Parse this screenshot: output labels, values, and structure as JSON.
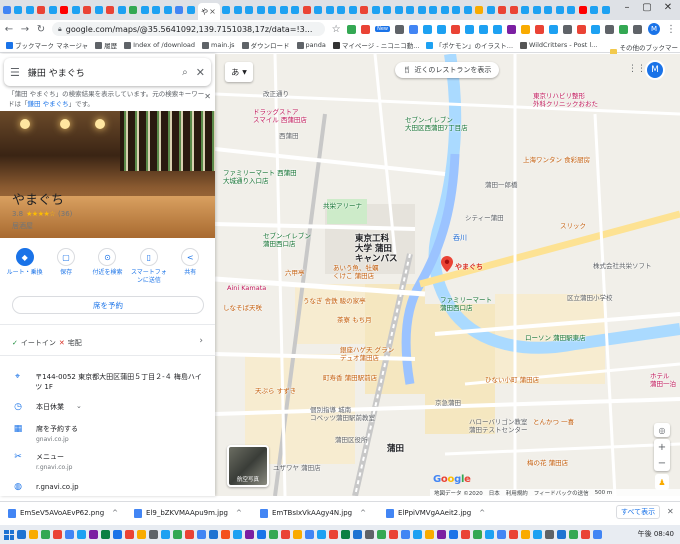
{
  "browser": {
    "active_tab_label": "や",
    "tab_colors": [
      "#4285f4",
      "#1da1f2",
      "#1da1f2",
      "#ea4335",
      "#1da1f2",
      "#ff0000",
      "#1da1f2",
      "#ea4335",
      "#1da1f2",
      "#ea4335",
      "#1da1f2",
      "#34a853",
      "#1da1f2",
      "#1da1f2",
      "#1da1f2",
      "#4285f4",
      "#1da1f2",
      "#1da1f2",
      "#1da1f2",
      "#1da1f2",
      "#1da1f2",
      "#1da1f2",
      "#1da1f2",
      "#1da1f2",
      "#ea4335",
      "#1da1f2",
      "#1da1f2",
      "#1da1f2",
      "#1da1f2",
      "#ea4335",
      "#1da1f2",
      "#1da1f2",
      "#1da1f2",
      "#1da1f2",
      "#1da1f2",
      "#1da1f2",
      "#1da1f2",
      "#1da1f2",
      "#1da1f2",
      "#f9ab00",
      "#1da1f2",
      "#ea4335",
      "#ea4335",
      "#1da1f2",
      "#1da1f2",
      "#1da1f2",
      "#1da1f2",
      "#1da1f2",
      "#ff0000",
      "#1da1f2",
      "#1da1f2"
    ],
    "url": "google.com/maps/@35.5641092,139.7151038,17z/data=!3...",
    "new_badge": "New",
    "account_initial": "M"
  },
  "bookmarks": [
    {
      "label": "ブックマーク マネージャ",
      "color": "#1a73e8"
    },
    {
      "label": "履歴",
      "color": "#5f6368"
    },
    {
      "label": "Index of /download",
      "color": "#5f6368"
    },
    {
      "label": "main.js",
      "color": "#5f6368"
    },
    {
      "label": "ダウンロード",
      "color": "#5f6368"
    },
    {
      "label": "panda",
      "color": "#5f6368"
    },
    {
      "label": "マイページ - ニコニコ動...",
      "color": "#333333"
    },
    {
      "label": "「ポケモン」のイラスト...",
      "color": "#1da1f2"
    },
    {
      "label": "WildCritters - Post l...",
      "color": "#555555"
    }
  ],
  "other_bookmarks": "その他のブックマーク",
  "panel": {
    "search_value": "鎌田 やまぐち",
    "notice_prefix": "「蒲田 やまぐち」の検索結果を表示しています。元の検索キーワードは「",
    "notice_term": "鎌田 やまぐち",
    "notice_suffix": "」です。",
    "place_name": "やまぐち",
    "rating_value": "3.8",
    "stars": "★★★★☆",
    "review_count": "(36)",
    "category": "居酒屋",
    "actions": [
      {
        "label": "ルート・乗換",
        "icon": "◆"
      },
      {
        "label": "保存",
        "icon": "▢"
      },
      {
        "label": "付近を検索",
        "icon": "⊙"
      },
      {
        "label": "スマートフォンに送信",
        "icon": "▯"
      },
      {
        "label": "共有",
        "icon": "<"
      }
    ],
    "reserve_label": "席を予約",
    "service_eatin": "イートイン",
    "service_takeout": "宅配",
    "address": "〒144-0052 東京都大田区蒲田５丁目２-４ 梅島ハイツ 1F",
    "hours": "本日休業",
    "reserve_row": "席を予約する",
    "reserve_row_sub": "gnavi.co.jp",
    "menu_row": "メニュー",
    "menu_row_sub": "r.gnavi.co.jp",
    "website": "r.gnavi.co.jp"
  },
  "map": {
    "lang_label": "あ",
    "nearby_label": "近くのレストランを表示",
    "pin_label": "やまぐち",
    "sat_label": "航空写真",
    "labels": [
      {
        "t": "ドラッグストア\nスマイル 西蒲田店",
        "c": "ml-pink"
      },
      {
        "t": "改正通り",
        "c": ""
      },
      {
        "t": "西蒲田",
        "c": ""
      },
      {
        "t": "セブン-イレブン\n大田区西蒲田7丁目店",
        "c": "ml-green"
      },
      {
        "t": "ファミリーマート 西蒲田\n大城通り入口店",
        "c": "ml-green"
      },
      {
        "t": "共栄アリーナ",
        "c": "ml-green"
      },
      {
        "t": "セブン-イレブン\n蒲田西口店",
        "c": "ml-green"
      },
      {
        "t": "東京工科\n大学 蒲田\nキャンパス",
        "c": "ml-big"
      },
      {
        "t": "あいう魚、牡蠣\nくけこ 蒲田店",
        "c": "ml-orange"
      },
      {
        "t": "うなぎ 舎鉄 駿の家亭",
        "c": "ml-orange"
      },
      {
        "t": "茶寮 もち月",
        "c": "ml-orange"
      },
      {
        "t": "しなそば天咲",
        "c": "ml-orange"
      },
      {
        "t": "銀座ハゲ天 グラン\nデュオ蒲田店",
        "c": "ml-orange"
      },
      {
        "t": "町寿香 蒲田駅前店",
        "c": "ml-orange"
      },
      {
        "t": "天ぷら すずき",
        "c": "ml-orange"
      },
      {
        "t": "個別指導 城南\nコベッツ蒲田駅前教室",
        "c": ""
      },
      {
        "t": "蒲田区役所",
        "c": ""
      },
      {
        "t": "ユザワヤ 蒲田店",
        "c": ""
      },
      {
        "t": "蒲田",
        "c": "ml-big"
      },
      {
        "t": "東京リハビリ整形\n外科クリニックおおた",
        "c": "ml-pink"
      },
      {
        "t": "上海ワンタン 食彩厨房",
        "c": "ml-orange"
      },
      {
        "t": "蒲田一郎橋",
        "c": ""
      },
      {
        "t": "シティー蒲田",
        "c": ""
      },
      {
        "t": "スリック",
        "c": "ml-orange"
      },
      {
        "t": "株式会社共栄ソフト",
        "c": ""
      },
      {
        "t": "ファミリーマート\n蒲田西口店",
        "c": "ml-green"
      },
      {
        "t": "ローソン 蒲田駅東店",
        "c": "ml-green"
      },
      {
        "t": "区立蒲田小学校",
        "c": ""
      },
      {
        "t": "ひない小町 蒲田店",
        "c": "ml-orange"
      },
      {
        "t": "ハローバリゴン教室\n蒲田テストセンター",
        "c": ""
      },
      {
        "t": "とんかつ 一喜",
        "c": "ml-orange"
      },
      {
        "t": "梅の花 蒲田店",
        "c": "ml-orange"
      },
      {
        "t": "呑川",
        "c": "ml-river"
      },
      {
        "t": "ホテル\n蒲田一泊",
        "c": "ml-pink"
      },
      {
        "t": "Aini Kamata",
        "c": "ml-pink"
      },
      {
        "t": "六甲亭",
        "c": "ml-orange"
      },
      {
        "t": "京急蒲田",
        "c": ""
      }
    ],
    "footer": [
      "地図データ ©2020",
      "日本",
      "利用規約",
      "フィードバックの送信",
      "500 m"
    ]
  },
  "downloads": [
    "EmSeV5AVoAEvP62.png",
    "El9_bZKVMAApu9m.jpg",
    "EmTBsIxVkAAgy4N.jpg",
    "ElPpiVMVgAAeit2.jpg"
  ],
  "show_all": "すべて表示",
  "taskbar_time": "午後 08:40",
  "taskbar_colors": [
    "#1e73d2",
    "#f9ab00",
    "#34a853",
    "#ea4335",
    "#4285f4",
    "#1da1f2",
    "#7b1fa2",
    "#0b8043",
    "#1a73e8",
    "#ea4335",
    "#f9ab00",
    "#5f6368",
    "#1da1f2",
    "#34a853",
    "#ea4335",
    "#4285f4",
    "#1e73d2",
    "#f4511e",
    "#1da1f2",
    "#7b1fa2",
    "#1a73e8",
    "#34a853",
    "#ea4335",
    "#f9ab00",
    "#4285f4",
    "#1da1f2",
    "#ea4335",
    "#0b8043",
    "#1e73d2",
    "#5f6368",
    "#34a853",
    "#ea4335",
    "#4285f4",
    "#1da1f2",
    "#f9ab00",
    "#7b1fa2",
    "#1a73e8",
    "#ea4335",
    "#34a853",
    "#1da1f2",
    "#4285f4",
    "#ea4335",
    "#f9ab00",
    "#1da1f2",
    "#5f6368",
    "#1e73d2",
    "#34a853",
    "#ea4335",
    "#4285f4"
  ]
}
